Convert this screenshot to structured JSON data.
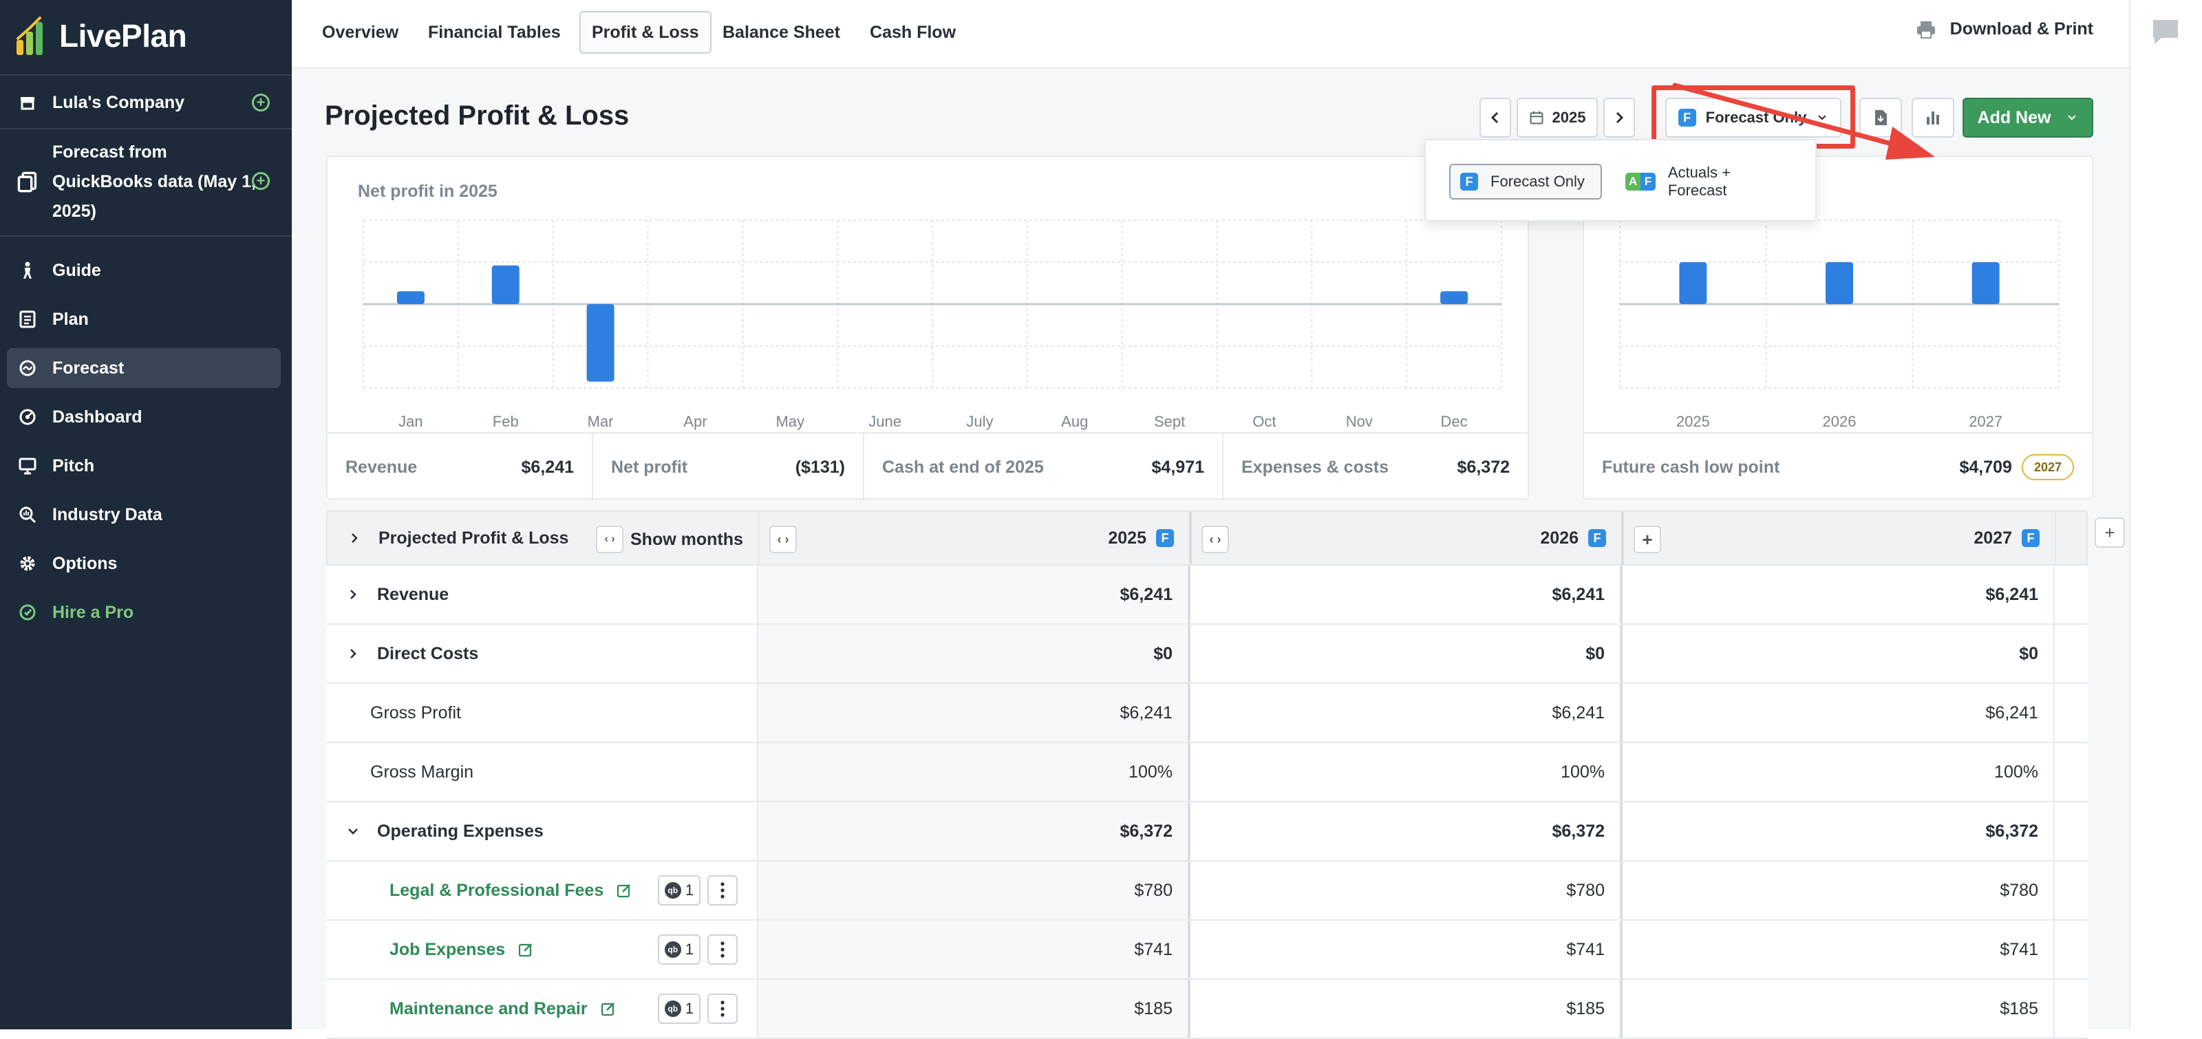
{
  "app": {
    "name": "LivePlan"
  },
  "sidebar": {
    "company": "Lula's Company",
    "forecast_source": "Forecast from QuickBooks data (May 1, 2025)",
    "items": [
      {
        "label": "Guide",
        "icon": "guide-icon"
      },
      {
        "label": "Plan",
        "icon": "plan-icon"
      },
      {
        "label": "Forecast",
        "icon": "forecast-icon",
        "active": true
      },
      {
        "label": "Dashboard",
        "icon": "dashboard-icon"
      },
      {
        "label": "Pitch",
        "icon": "pitch-icon"
      },
      {
        "label": "Industry Data",
        "icon": "industry-data-icon"
      },
      {
        "label": "Options",
        "icon": "gear-icon"
      },
      {
        "label": "Hire a Pro",
        "icon": "hire-pro-icon"
      }
    ]
  },
  "topnav": {
    "tabs": [
      "Overview",
      "Financial Tables",
      "Profit & Loss",
      "Balance Sheet",
      "Cash Flow"
    ],
    "active_tab": "Profit & Loss",
    "download_print": "Download & Print"
  },
  "toolbar": {
    "page_title": "Projected Profit & Loss",
    "year": "2025",
    "view_mode": "Forecast Only",
    "add_new": "Add New"
  },
  "dropdown": {
    "options": [
      "Forecast Only",
      "Actuals + Forecast"
    ],
    "selected": "Forecast Only"
  },
  "colors": {
    "sidebar_bg": "#1d2a39",
    "accent_green": "#3c9a5c",
    "bar_blue": "#2f7fe0",
    "highlight_red": "#e8453c",
    "link_green": "#2e8b57"
  },
  "chart_data": [
    {
      "type": "bar",
      "title": "Net profit in 2025",
      "categories": [
        "Jan",
        "Feb",
        "Mar",
        "Apr",
        "May",
        "June",
        "July",
        "Aug",
        "Sept",
        "Oct",
        "Nov",
        "Dec"
      ],
      "values": [
        1,
        3,
        -6,
        0,
        0,
        0,
        0,
        0,
        0,
        0,
        0,
        1
      ],
      "ylim": [
        -6.5,
        6.5
      ],
      "grid": true
    },
    {
      "type": "bar",
      "categories": [
        "2025",
        "2026",
        "2027"
      ],
      "values": [
        1,
        1,
        1
      ],
      "grid": true
    }
  ],
  "metrics": [
    {
      "label": "Revenue",
      "value": "$6,241"
    },
    {
      "label": "Net profit",
      "value": "($131)"
    },
    {
      "label": "Cash at end of 2025",
      "value": "$4,971"
    },
    {
      "label": "Expenses & costs",
      "value": "$6,372"
    }
  ],
  "future_cash": {
    "label": "Future cash low point",
    "value": "$4,709",
    "year": "2027"
  },
  "table": {
    "header_label": "Projected Profit & Loss",
    "show_months": "Show months",
    "years": [
      "2025",
      "2026",
      "2027"
    ],
    "year_badge": "F",
    "rows": [
      {
        "label": "Revenue",
        "values": [
          "$6,241",
          "$6,241",
          "$6,241"
        ]
      },
      {
        "label": "Direct Costs",
        "values": [
          "$0",
          "$0",
          "$0"
        ]
      },
      {
        "label": "Gross Profit",
        "values": [
          "$6,241",
          "$6,241",
          "$6,241"
        ]
      },
      {
        "label": "Gross Margin",
        "values": [
          "100%",
          "100%",
          "100%"
        ]
      },
      {
        "label": "Operating Expenses",
        "values": [
          "$6,372",
          "$6,372",
          "$6,372"
        ]
      },
      {
        "label": "Legal & Professional Fees",
        "count": "1",
        "values": [
          "$780",
          "$780",
          "$780"
        ]
      },
      {
        "label": "Job Expenses",
        "count": "1",
        "values": [
          "$741",
          "$741",
          "$741"
        ]
      },
      {
        "label": "Maintenance and Repair",
        "count": "1",
        "values": [
          "$185",
          "$185",
          "$185"
        ]
      }
    ]
  }
}
